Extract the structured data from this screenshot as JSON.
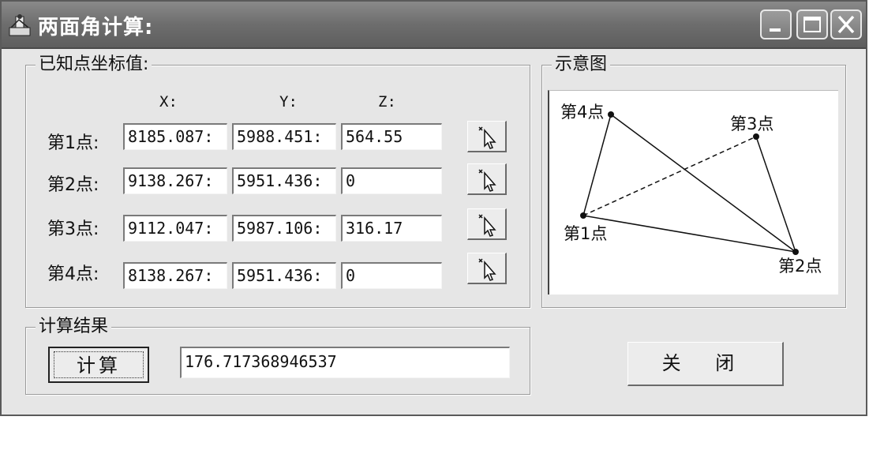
{
  "window": {
    "title": "两面角计算:",
    "controls": [
      "minimize-icon",
      "maximize-icon",
      "close-icon"
    ]
  },
  "known_points": {
    "group_label": "已知点坐标值:",
    "headers": {
      "x": "X:",
      "y": "Y:",
      "z": "Z:"
    },
    "rows": [
      {
        "label": "第1点:",
        "x": "8185.087:",
        "y": "5988.451:",
        "z": "564.55"
      },
      {
        "label": "第2点:",
        "x": "9138.267:",
        "y": "5951.436:",
        "z": "0"
      },
      {
        "label": "第3点:",
        "x": "9112.047:",
        "y": "5987.106:",
        "z": "316.17"
      },
      {
        "label": "第4点:",
        "x": "8138.267:",
        "y": "5951.436:",
        "z": "0"
      }
    ]
  },
  "diagram": {
    "group_label": "示意图",
    "points": {
      "p1": "第1点",
      "p2": "第2点",
      "p3": "第3点",
      "p4": "第4点"
    }
  },
  "result": {
    "group_label": "计算结果",
    "calc_label": "计算",
    "value": "176.717368946537"
  },
  "close_label": "关 闭"
}
